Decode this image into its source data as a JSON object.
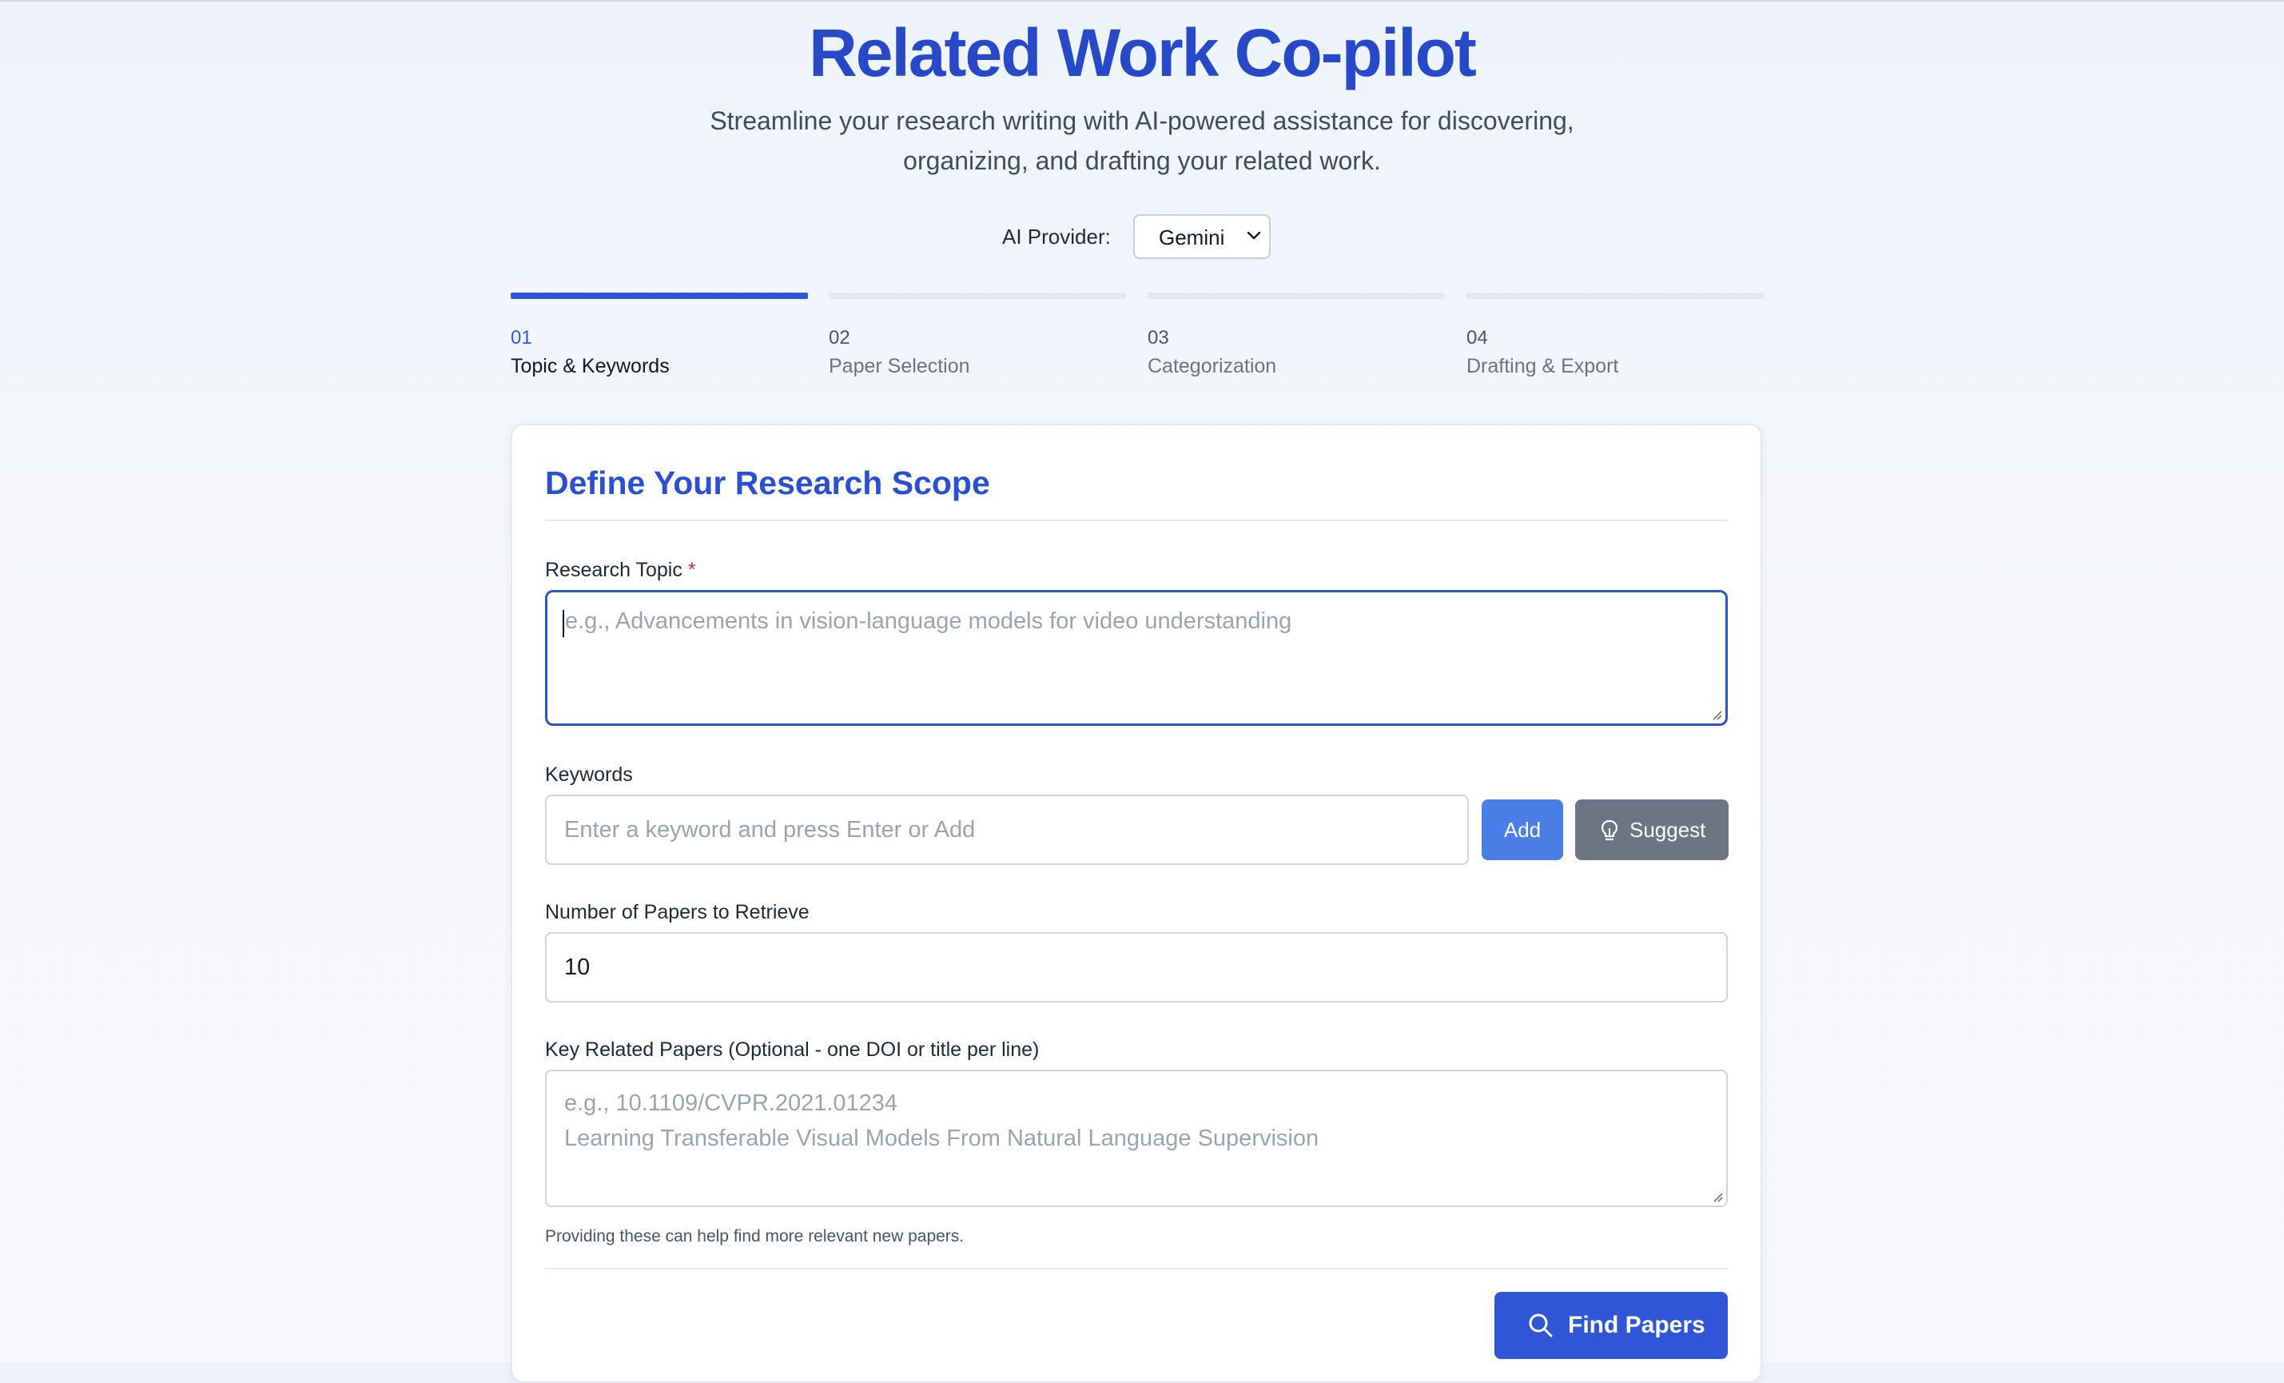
{
  "header": {
    "title": "Related Work Co-pilot",
    "subtitle": "Streamline your research writing with AI-powered assistance for discovering, organizing, and drafting your related work."
  },
  "provider": {
    "label": "AI Provider:",
    "selected": "Gemini",
    "icon": "chevron-down-icon"
  },
  "steps": [
    {
      "num": "01",
      "label": "Topic & Keywords",
      "active": true
    },
    {
      "num": "02",
      "label": "Paper Selection",
      "active": false
    },
    {
      "num": "03",
      "label": "Categorization",
      "active": false
    },
    {
      "num": "04",
      "label": "Drafting & Export",
      "active": false
    }
  ],
  "form": {
    "title": "Define Your Research Scope",
    "topic": {
      "label": "Research Topic",
      "required_mark": "*",
      "placeholder": "e.g., Advancements in vision-language models for video understanding",
      "value": ""
    },
    "keywords": {
      "label": "Keywords",
      "placeholder": "Enter a keyword and press Enter or Add",
      "add_label": "Add",
      "suggest_label": "Suggest",
      "suggest_icon": "lightbulb-icon"
    },
    "num_papers": {
      "label": "Number of Papers to Retrieve",
      "value": "10"
    },
    "key_papers": {
      "label": "Key Related Papers (Optional - one DOI or title per line)",
      "placeholder_line1": "e.g., 10.1109/CVPR.2021.01234",
      "placeholder_line2": "Learning Transferable Visual Models From Natural Language Supervision",
      "help": "Providing these can help find more relevant new papers."
    },
    "submit": {
      "label": "Find Papers",
      "icon": "search-icon"
    }
  },
  "colors": {
    "accent": "#2f56d6",
    "title": "#2749c8",
    "add_button": "#4a7de6",
    "suggest_button": "#6b7584",
    "required": "#dc2626"
  }
}
